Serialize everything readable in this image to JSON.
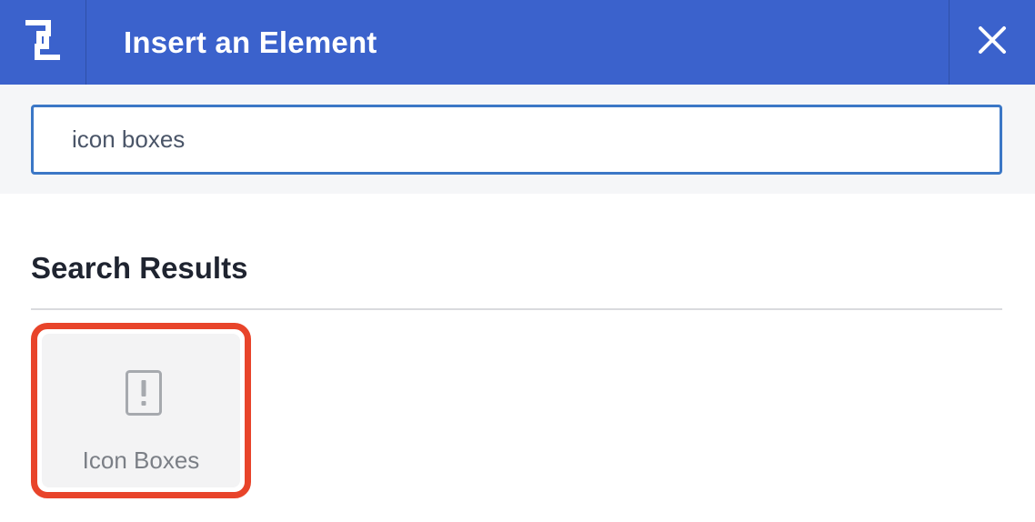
{
  "header": {
    "logo_icon": "bracket-logo-icon",
    "title": "Insert an Element",
    "close_icon": "close-icon",
    "background_color": "#3b62cc"
  },
  "search": {
    "value": "icon boxes",
    "border_color": "#3b77c6"
  },
  "results": {
    "heading": "Search Results",
    "items": [
      {
        "label": "Icon Boxes",
        "icon": "exclamation-box-icon",
        "highlight_color": "#e8442a"
      }
    ]
  }
}
